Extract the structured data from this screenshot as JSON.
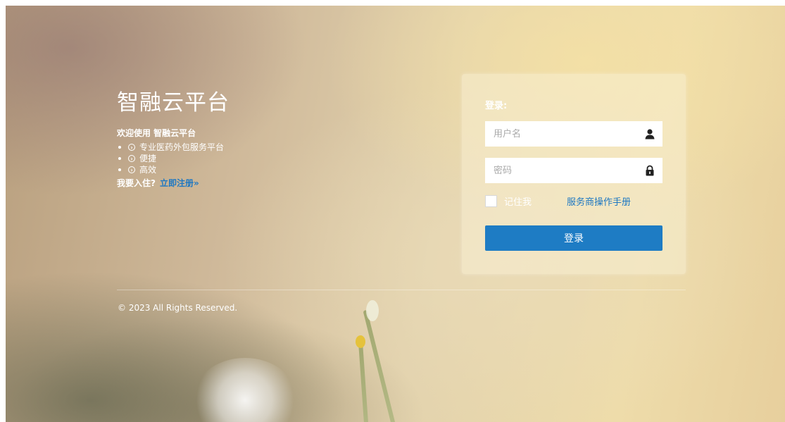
{
  "brand": {
    "title": "智融云平台",
    "welcome": "欢迎使用 智融云平台",
    "features": [
      {
        "label": "专业医药外包服务平台",
        "icon": "circle-arrow-icon"
      },
      {
        "label": "便捷",
        "icon": "circle-arrow-icon"
      },
      {
        "label": "高效",
        "icon": "circle-arrow-icon"
      }
    ],
    "register_prompt": "我要入住?",
    "register_link": "立即注册»"
  },
  "login": {
    "heading": "登录:",
    "username_placeholder": "用户名",
    "username_icon": "user-icon",
    "password_placeholder": "密码",
    "password_icon": "lock-icon",
    "remember_label": "记住我",
    "manual_link": "服务商操作手册",
    "submit_label": "登录"
  },
  "footer": {
    "copyright": "© 2023 All Rights Reserved."
  },
  "colors": {
    "accent": "#1e7cc4",
    "link": "#1e78c2"
  }
}
